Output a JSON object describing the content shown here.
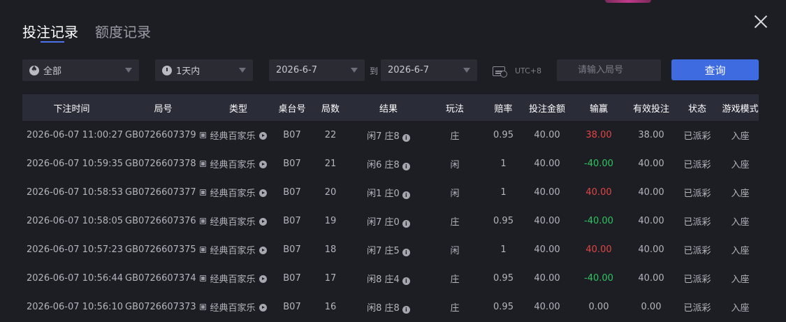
{
  "tabs": [
    {
      "label": "投注记录",
      "active": true
    },
    {
      "label": "额度记录",
      "active": false
    }
  ],
  "filters": {
    "game": "全部",
    "range": "1天内",
    "date_from": "2026-6-7",
    "to_label": "到",
    "date_to": "2026-6-7",
    "timezone": "UTC+8",
    "round_placeholder": "请输入局号",
    "query_label": "查询"
  },
  "table": {
    "headers": [
      "下注时间",
      "局号",
      "类型",
      "桌台号",
      "局数",
      "结果",
      "玩法",
      "赔率",
      "投注金额",
      "输赢",
      "有效投注",
      "状态",
      "游戏模式"
    ],
    "rows": [
      {
        "time": "2026-06-07 11:00:27",
        "id": "GB0726607379",
        "type": "经典百家乐",
        "table": "B07",
        "round": "22",
        "result": "闲7 庄8",
        "bet": "庄",
        "odds": "0.95",
        "amount": "40.00",
        "win": "38.00",
        "win_color": "red",
        "valid": "38.00",
        "status": "已派彩",
        "mode": "入座"
      },
      {
        "time": "2026-06-07 10:59:35",
        "id": "GB0726607378",
        "type": "经典百家乐",
        "table": "B07",
        "round": "21",
        "result": "闲6 庄8",
        "bet": "闲",
        "odds": "1",
        "amount": "40.00",
        "win": "-40.00",
        "win_color": "green",
        "valid": "40.00",
        "status": "已派彩",
        "mode": "入座"
      },
      {
        "time": "2026-06-07 10:58:53",
        "id": "GB0726607377",
        "type": "经典百家乐",
        "table": "B07",
        "round": "20",
        "result": "闲1 庄0",
        "bet": "闲",
        "odds": "1",
        "amount": "40.00",
        "win": "40.00",
        "win_color": "red",
        "valid": "40.00",
        "status": "已派彩",
        "mode": "入座"
      },
      {
        "time": "2026-06-07 10:58:05",
        "id": "GB0726607376",
        "type": "经典百家乐",
        "table": "B07",
        "round": "19",
        "result": "闲7 庄0",
        "bet": "庄",
        "odds": "0.95",
        "amount": "40.00",
        "win": "-40.00",
        "win_color": "green",
        "valid": "40.00",
        "status": "已派彩",
        "mode": "入座"
      },
      {
        "time": "2026-06-07 10:57:23",
        "id": "GB0726607375",
        "type": "经典百家乐",
        "table": "B07",
        "round": "18",
        "result": "闲7 庄5",
        "bet": "闲",
        "odds": "1",
        "amount": "40.00",
        "win": "40.00",
        "win_color": "red",
        "valid": "40.00",
        "status": "已派彩",
        "mode": "入座"
      },
      {
        "time": "2026-06-07 10:56:44",
        "id": "GB0726607374",
        "type": "经典百家乐",
        "table": "B07",
        "round": "17",
        "result": "闲8 庄4",
        "bet": "庄",
        "odds": "0.95",
        "amount": "40.00",
        "win": "-40.00",
        "win_color": "green",
        "valid": "40.00",
        "status": "已派彩",
        "mode": "入座"
      },
      {
        "time": "2026-06-07 10:56:10",
        "id": "GB0726607373",
        "type": "经典百家乐",
        "table": "B07",
        "round": "16",
        "result": "闲8 庄8",
        "bet": "庄",
        "odds": "0.95",
        "amount": "40.00",
        "win": "0.00",
        "win_color": "normal",
        "valid": "0.00",
        "status": "已派彩",
        "mode": "入座"
      }
    ]
  },
  "colors": {
    "accent": "#3f6be0",
    "loss": "#e04545",
    "gain": "#2fc55f",
    "background": "#1d1e24"
  },
  "icons": {
    "close": "close-icon",
    "game": "spade-icon",
    "range": "clock-icon",
    "timezone": "calendar-clock-icon",
    "round": "ticket-icon",
    "copy": "copy-icon",
    "replay": "play-icon",
    "detail": "info-icon"
  }
}
